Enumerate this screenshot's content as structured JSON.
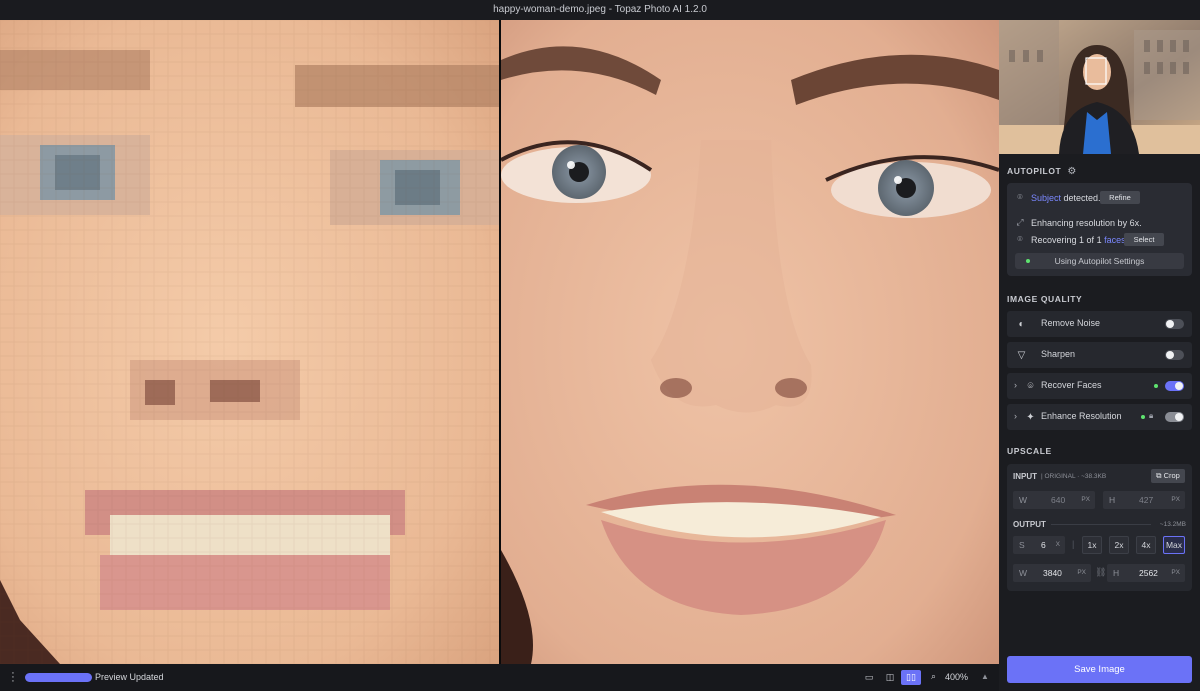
{
  "window": {
    "title": "happy-woman-demo.jpeg - Topaz Photo AI 1.2.0"
  },
  "autopilot": {
    "heading": "AUTOPILOT",
    "subject_word": "Subject",
    "subject_rest": " detected.",
    "refine_label": "Refine",
    "enhancing_text": "Enhancing resolution by 6x.",
    "recovering_prefix": "Recovering ",
    "recovering_count": "1",
    "recovering_mid": " of ",
    "recovering_total": "1",
    "recovering_suffix": " faces",
    "recovering_dot": ".",
    "select_label": "Select",
    "settings_label": "Using Autopilot Settings"
  },
  "image_quality": {
    "heading": "IMAGE QUALITY",
    "items": [
      {
        "label": "Remove Noise",
        "enabled": false
      },
      {
        "label": "Sharpen",
        "enabled": false
      },
      {
        "label": "Recover Faces",
        "enabled": true
      },
      {
        "label": "Enhance Resolution",
        "enabled": true,
        "locked": true
      }
    ]
  },
  "upscale": {
    "heading": "UPSCALE",
    "input_label": "INPUT",
    "input_meta": "| ORIGINAL · ~38.3KB",
    "crop_label": "Crop",
    "input_w_key": "W",
    "input_w": "640",
    "input_w_unit": "PX",
    "input_h_key": "H",
    "input_h": "427",
    "input_h_unit": "PX",
    "output_label": "OUTPUT",
    "output_size": "~13.2MB",
    "scale_key": "S",
    "scale_value": "6",
    "scale_unit": "X",
    "multipliers": [
      "1x",
      "2x",
      "4x",
      "Max"
    ],
    "selected_multiplier": "Max",
    "output_w_key": "W",
    "output_w": "3840",
    "output_w_unit": "PX",
    "output_h_key": "H",
    "output_h": "2562",
    "output_h_unit": "PX"
  },
  "save_label": "Save Image",
  "bottom": {
    "status": "Preview Updated",
    "zoom": "400%"
  },
  "colors": {
    "accent": "#6b72f7",
    "panel": "#1b1c20",
    "card": "#2a2c33",
    "active_dot": "#5ee36f"
  }
}
